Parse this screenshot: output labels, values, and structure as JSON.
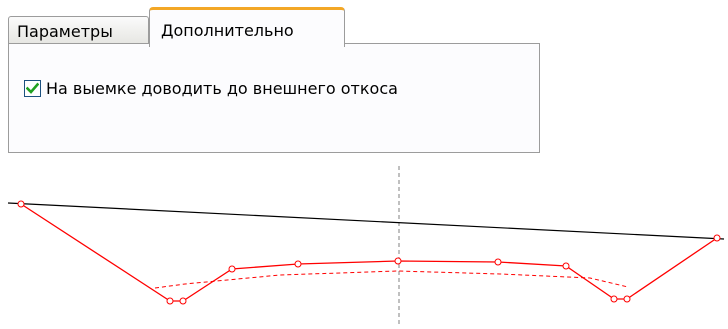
{
  "tabs": [
    {
      "label": "Параметры",
      "active": false
    },
    {
      "label": "Дополнительно",
      "active": true
    }
  ],
  "options": {
    "extend_to_outer_slope": {
      "label": "На выемке доводить до внешнего откоса",
      "checked": true
    }
  },
  "colors": {
    "tab_active_accent": "#f3a726",
    "checkbox_mark": "#21a121",
    "design_line": "#ff0000",
    "ground_line": "#000000",
    "axis_line": "#808080"
  }
}
